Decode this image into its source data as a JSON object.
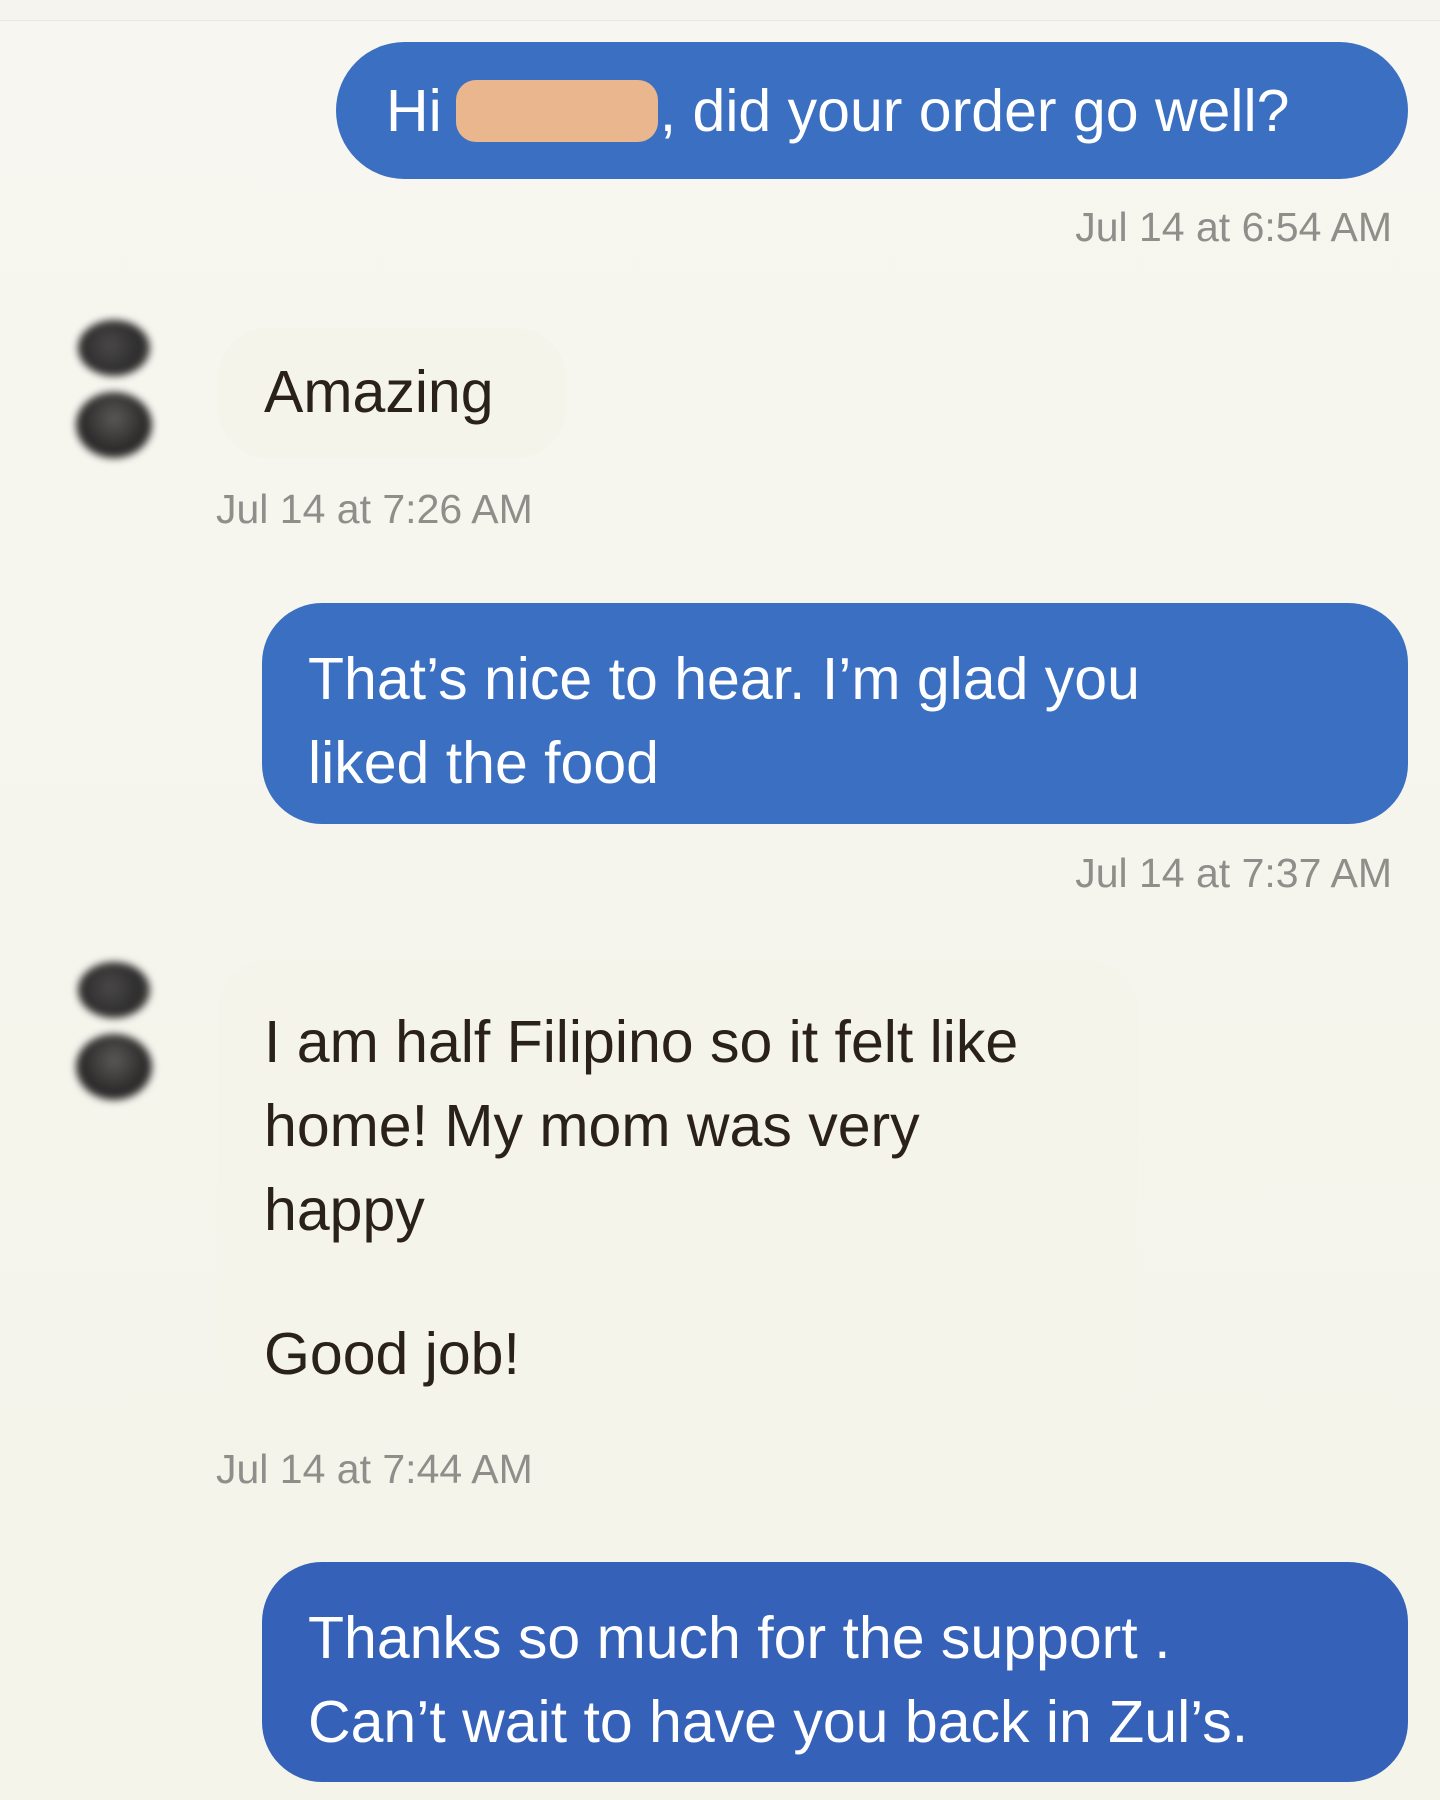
{
  "conversation": {
    "messages": [
      {
        "id": "m1",
        "direction": "outgoing",
        "text_before": "Hi",
        "redacted": true,
        "text_after": ", did your order go well?",
        "timestamp": "Jul 14 at 6:54 AM"
      },
      {
        "id": "m2",
        "direction": "incoming",
        "text": "Amazing",
        "timestamp": "Jul 14 at 7:26 AM"
      },
      {
        "id": "m3",
        "direction": "outgoing",
        "lines": [
          "That’s nice to hear. I’m glad you",
          "liked the food"
        ],
        "timestamp": "Jul 14 at 7:37 AM"
      },
      {
        "id": "m4",
        "direction": "incoming",
        "lines": [
          "I am half Filipino so it felt like",
          "home! My mom was very",
          "happy"
        ],
        "extra": "Good job!",
        "timestamp": "Jul 14 at 7:44 AM"
      },
      {
        "id": "m5",
        "direction": "outgoing",
        "lines": [
          "Thanks so much for the support .",
          "Can’t wait to have you back in Zul’s."
        ]
      }
    ]
  },
  "colors": {
    "background": "#f6f5ee",
    "outgoing_bubble": "#3b6fc1",
    "incoming_bubble": "#f4f4eb",
    "timestamp_text": "#8f8e8a",
    "redaction": "#e9b68d"
  }
}
